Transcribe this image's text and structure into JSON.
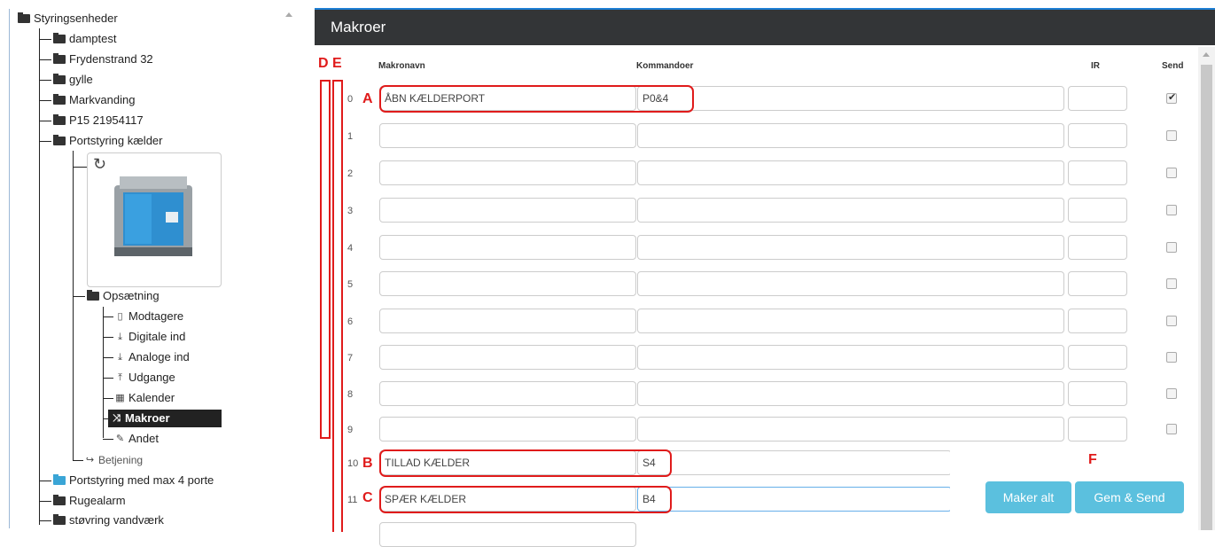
{
  "tree": {
    "root": "Styringsenheder",
    "items": [
      "damptest",
      "Frydenstrand 32",
      "gylle",
      "Markvanding",
      "P15 21954117",
      "Portstyring kælder"
    ],
    "setup": "Opsætning",
    "setup_items": [
      "Modtagere",
      "Digitale ind",
      "Analoge ind",
      "Udgange",
      "Kalender",
      "Makroer",
      "Andet"
    ],
    "operation": "Betjening",
    "more_items": [
      "Portstyring med max 4 porte",
      "Rugealarm",
      "støvring vandværk"
    ]
  },
  "panel": {
    "title": "Makroer",
    "col_name": "Makronavn",
    "col_cmd": "Kommandoer",
    "col_ir": "IR",
    "col_send": "Send",
    "rows": [
      {
        "num": "0",
        "name": "ÅBN KÆLDERPORT",
        "cmd": "P0&4",
        "send": true
      },
      {
        "num": "1",
        "name": "",
        "cmd": "",
        "send": false
      },
      {
        "num": "2",
        "name": "",
        "cmd": "",
        "send": false
      },
      {
        "num": "3",
        "name": "",
        "cmd": "",
        "send": false
      },
      {
        "num": "4",
        "name": "",
        "cmd": "",
        "send": false
      },
      {
        "num": "5",
        "name": "",
        "cmd": "",
        "send": false
      },
      {
        "num": "6",
        "name": "",
        "cmd": "",
        "send": false
      },
      {
        "num": "7",
        "name": "",
        "cmd": "",
        "send": false
      },
      {
        "num": "8",
        "name": "",
        "cmd": "",
        "send": false
      },
      {
        "num": "9",
        "name": "",
        "cmd": "",
        "send": false
      },
      {
        "num": "10",
        "name": "TILLAD KÆLDER",
        "cmd": "S4"
      },
      {
        "num": "11",
        "name": "SPÆR KÆLDER",
        "cmd": "B4"
      }
    ],
    "btn_clear": "Maker alt",
    "btn_save": "Gem & Send"
  },
  "annotations": {
    "A": "A",
    "B": "B",
    "C": "C",
    "D": "D",
    "E": "E",
    "F": "F"
  },
  "colors": {
    "header": "#333537",
    "accent": "#5bc0de",
    "annotation": "#e01b1b"
  }
}
